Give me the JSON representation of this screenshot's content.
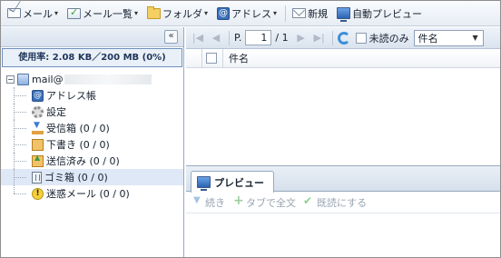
{
  "toolbar": {
    "mail_label": "メール",
    "mail_list_label": "メール一覧",
    "folder_label": "フォルダ",
    "address_label": "アドレス",
    "new_label": "新規",
    "auto_preview_label": "自動プレビュー"
  },
  "sidebar": {
    "usage_text": "使用率: 2.08 KB／200 MB (0%)",
    "account_label": "mail@",
    "items": [
      {
        "label": "アドレス帳",
        "icon": "address-book-icon"
      },
      {
        "label": "設定",
        "icon": "gear-icon"
      },
      {
        "label": "受信箱 (0 / 0)",
        "icon": "inbox-icon"
      },
      {
        "label": "下書き (0 / 0)",
        "icon": "draft-icon"
      },
      {
        "label": "送信済み (0 / 0)",
        "icon": "sent-icon"
      },
      {
        "label": "ゴミ箱 (0 / 0)",
        "icon": "trash-icon"
      },
      {
        "label": "迷惑メール (0 / 0)",
        "icon": "spam-icon"
      }
    ],
    "selected_index": 5
  },
  "message_list": {
    "page_prefix": "P.",
    "page_value": "1",
    "page_total": "/ 1",
    "unread_only_label": "未読のみ",
    "sort_select_value": "件名",
    "columns": [
      "件名"
    ]
  },
  "preview": {
    "tab_label": "プレビュー",
    "continue_label": "続き",
    "open_in_tab_label": "タブで全文",
    "mark_read_label": "既読にする"
  },
  "colors": {
    "selection": "#dfe8f6",
    "usage_border": "#6d8fbf",
    "address_icon": "#3a6eb8"
  }
}
